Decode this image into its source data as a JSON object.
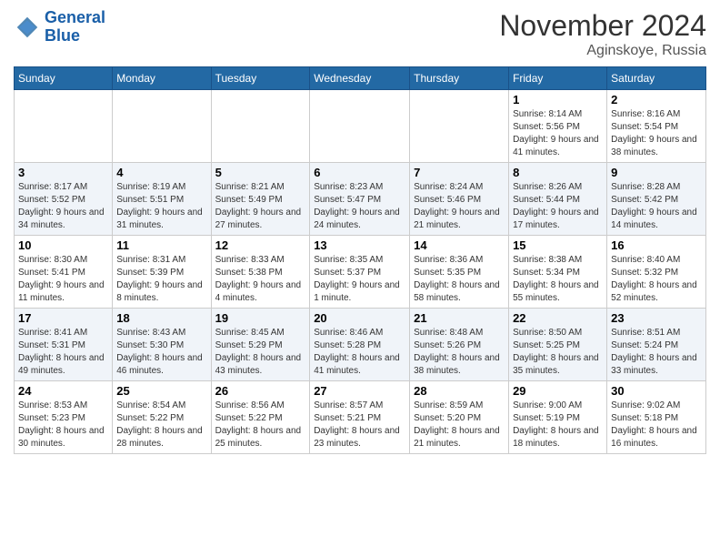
{
  "header": {
    "logo_line1": "General",
    "logo_line2": "Blue",
    "month": "November 2024",
    "location": "Aginskoye, Russia"
  },
  "days_of_week": [
    "Sunday",
    "Monday",
    "Tuesday",
    "Wednesday",
    "Thursday",
    "Friday",
    "Saturday"
  ],
  "weeks": [
    [
      {
        "day": "",
        "info": ""
      },
      {
        "day": "",
        "info": ""
      },
      {
        "day": "",
        "info": ""
      },
      {
        "day": "",
        "info": ""
      },
      {
        "day": "",
        "info": ""
      },
      {
        "day": "1",
        "info": "Sunrise: 8:14 AM\nSunset: 5:56 PM\nDaylight: 9 hours\nand 41 minutes."
      },
      {
        "day": "2",
        "info": "Sunrise: 8:16 AM\nSunset: 5:54 PM\nDaylight: 9 hours\nand 38 minutes."
      }
    ],
    [
      {
        "day": "3",
        "info": "Sunrise: 8:17 AM\nSunset: 5:52 PM\nDaylight: 9 hours\nand 34 minutes."
      },
      {
        "day": "4",
        "info": "Sunrise: 8:19 AM\nSunset: 5:51 PM\nDaylight: 9 hours\nand 31 minutes."
      },
      {
        "day": "5",
        "info": "Sunrise: 8:21 AM\nSunset: 5:49 PM\nDaylight: 9 hours\nand 27 minutes."
      },
      {
        "day": "6",
        "info": "Sunrise: 8:23 AM\nSunset: 5:47 PM\nDaylight: 9 hours\nand 24 minutes."
      },
      {
        "day": "7",
        "info": "Sunrise: 8:24 AM\nSunset: 5:46 PM\nDaylight: 9 hours\nand 21 minutes."
      },
      {
        "day": "8",
        "info": "Sunrise: 8:26 AM\nSunset: 5:44 PM\nDaylight: 9 hours\nand 17 minutes."
      },
      {
        "day": "9",
        "info": "Sunrise: 8:28 AM\nSunset: 5:42 PM\nDaylight: 9 hours\nand 14 minutes."
      }
    ],
    [
      {
        "day": "10",
        "info": "Sunrise: 8:30 AM\nSunset: 5:41 PM\nDaylight: 9 hours\nand 11 minutes."
      },
      {
        "day": "11",
        "info": "Sunrise: 8:31 AM\nSunset: 5:39 PM\nDaylight: 9 hours\nand 8 minutes."
      },
      {
        "day": "12",
        "info": "Sunrise: 8:33 AM\nSunset: 5:38 PM\nDaylight: 9 hours\nand 4 minutes."
      },
      {
        "day": "13",
        "info": "Sunrise: 8:35 AM\nSunset: 5:37 PM\nDaylight: 9 hours\nand 1 minute."
      },
      {
        "day": "14",
        "info": "Sunrise: 8:36 AM\nSunset: 5:35 PM\nDaylight: 8 hours\nand 58 minutes."
      },
      {
        "day": "15",
        "info": "Sunrise: 8:38 AM\nSunset: 5:34 PM\nDaylight: 8 hours\nand 55 minutes."
      },
      {
        "day": "16",
        "info": "Sunrise: 8:40 AM\nSunset: 5:32 PM\nDaylight: 8 hours\nand 52 minutes."
      }
    ],
    [
      {
        "day": "17",
        "info": "Sunrise: 8:41 AM\nSunset: 5:31 PM\nDaylight: 8 hours\nand 49 minutes."
      },
      {
        "day": "18",
        "info": "Sunrise: 8:43 AM\nSunset: 5:30 PM\nDaylight: 8 hours\nand 46 minutes."
      },
      {
        "day": "19",
        "info": "Sunrise: 8:45 AM\nSunset: 5:29 PM\nDaylight: 8 hours\nand 43 minutes."
      },
      {
        "day": "20",
        "info": "Sunrise: 8:46 AM\nSunset: 5:28 PM\nDaylight: 8 hours\nand 41 minutes."
      },
      {
        "day": "21",
        "info": "Sunrise: 8:48 AM\nSunset: 5:26 PM\nDaylight: 8 hours\nand 38 minutes."
      },
      {
        "day": "22",
        "info": "Sunrise: 8:50 AM\nSunset: 5:25 PM\nDaylight: 8 hours\nand 35 minutes."
      },
      {
        "day": "23",
        "info": "Sunrise: 8:51 AM\nSunset: 5:24 PM\nDaylight: 8 hours\nand 33 minutes."
      }
    ],
    [
      {
        "day": "24",
        "info": "Sunrise: 8:53 AM\nSunset: 5:23 PM\nDaylight: 8 hours\nand 30 minutes."
      },
      {
        "day": "25",
        "info": "Sunrise: 8:54 AM\nSunset: 5:22 PM\nDaylight: 8 hours\nand 28 minutes."
      },
      {
        "day": "26",
        "info": "Sunrise: 8:56 AM\nSunset: 5:22 PM\nDaylight: 8 hours\nand 25 minutes."
      },
      {
        "day": "27",
        "info": "Sunrise: 8:57 AM\nSunset: 5:21 PM\nDaylight: 8 hours\nand 23 minutes."
      },
      {
        "day": "28",
        "info": "Sunrise: 8:59 AM\nSunset: 5:20 PM\nDaylight: 8 hours\nand 21 minutes."
      },
      {
        "day": "29",
        "info": "Sunrise: 9:00 AM\nSunset: 5:19 PM\nDaylight: 8 hours\nand 18 minutes."
      },
      {
        "day": "30",
        "info": "Sunrise: 9:02 AM\nSunset: 5:18 PM\nDaylight: 8 hours\nand 16 minutes."
      }
    ]
  ]
}
